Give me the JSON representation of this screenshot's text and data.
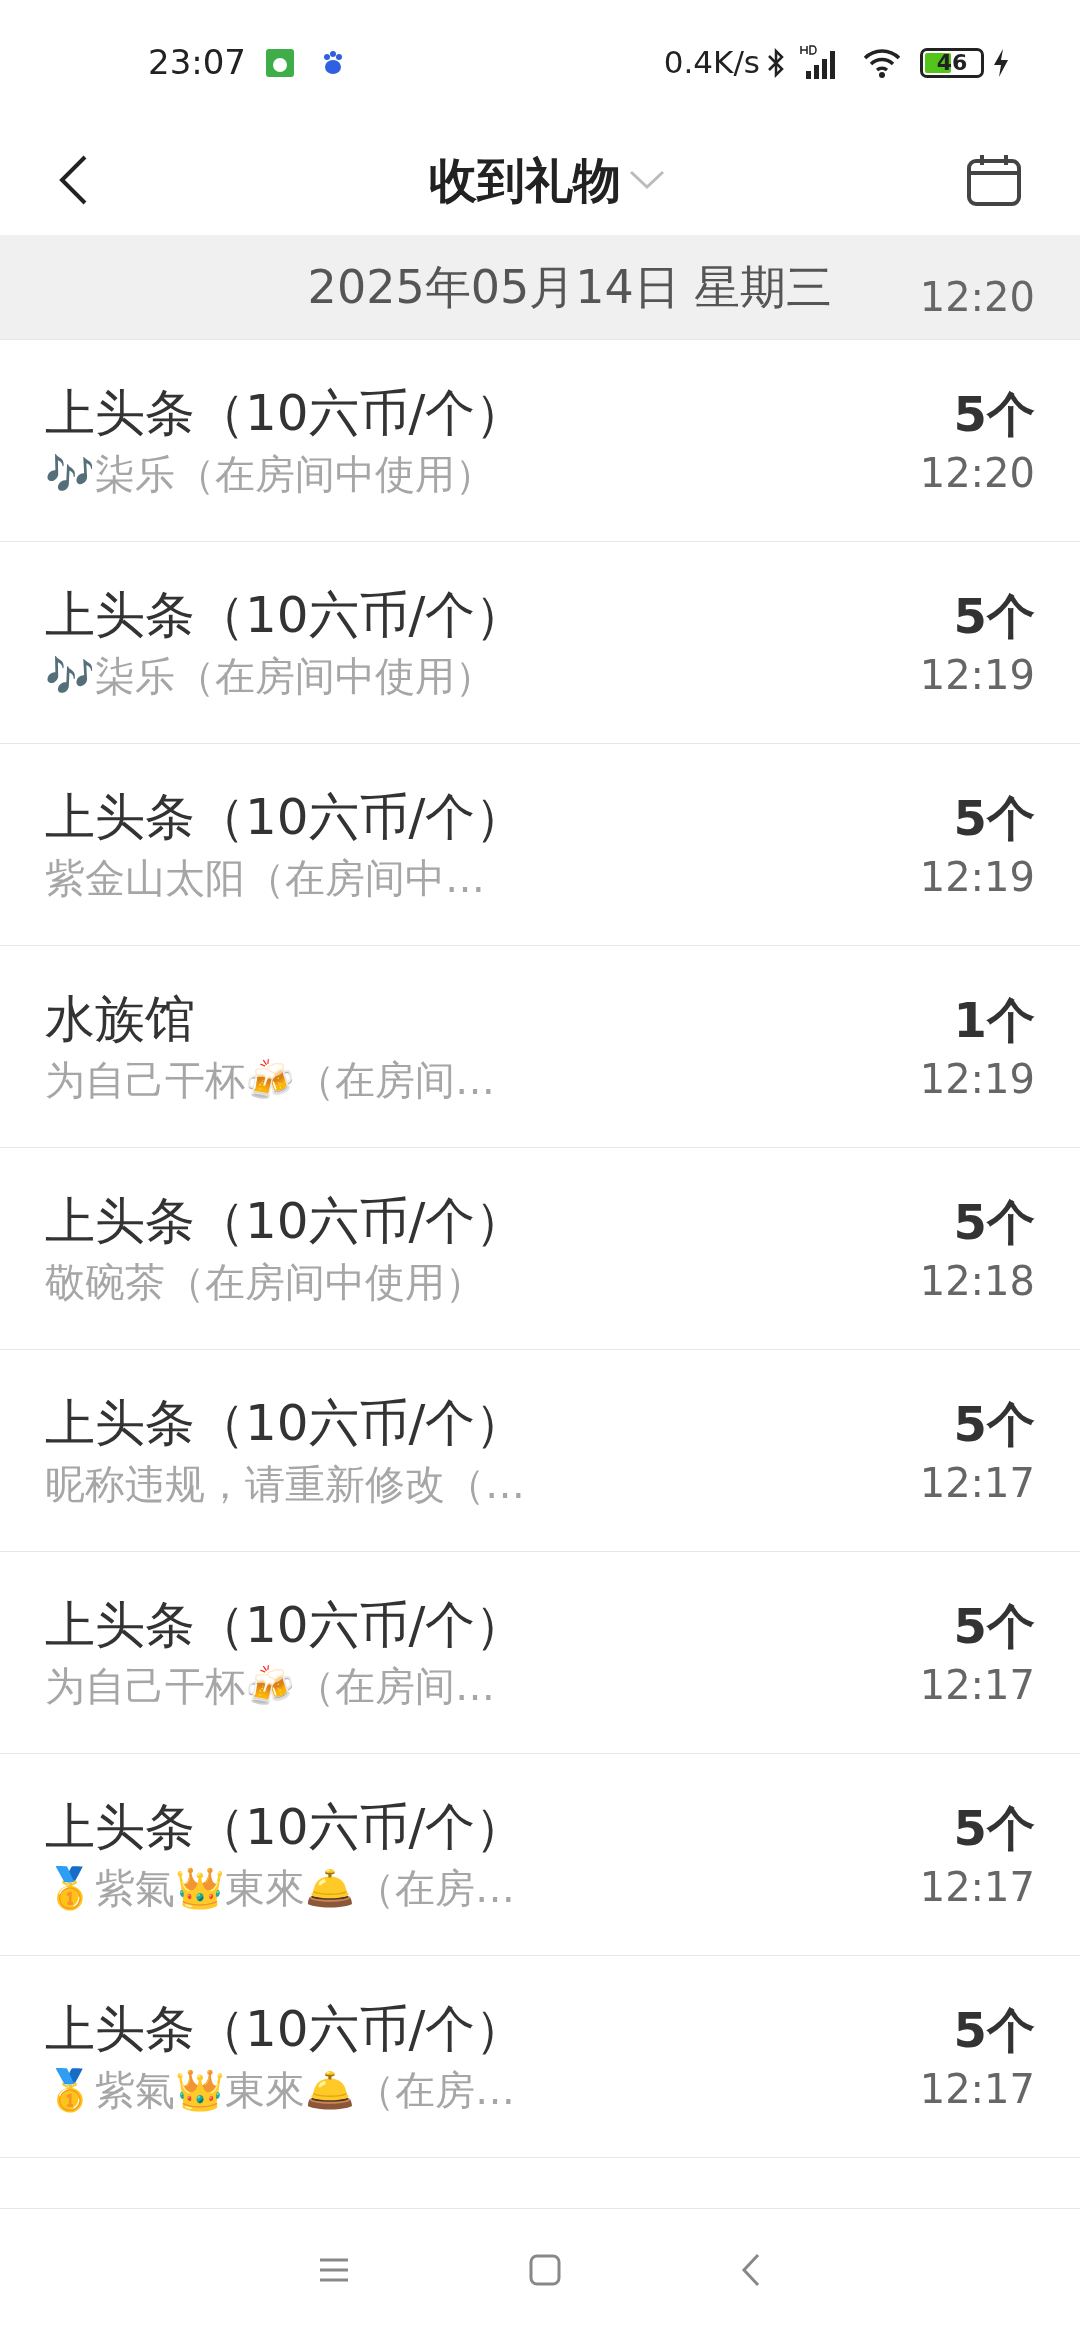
{
  "status_bar": {
    "time": "23:07",
    "net_speed": "0.4K/s",
    "battery": "46"
  },
  "header": {
    "title": "收到礼物"
  },
  "date_header": "2025年05月14日 星期三",
  "partial_row": {
    "time": "12:20"
  },
  "gifts": [
    {
      "name": "上头条（10六币/个）",
      "sender": "🎶柒乐（在房间中使用）",
      "count": "5个",
      "time": "12:20"
    },
    {
      "name": "上头条（10六币/个）",
      "sender": "🎶柒乐（在房间中使用）",
      "count": "5个",
      "time": "12:19"
    },
    {
      "name": "上头条（10六币/个）",
      "sender": "紫金山太阳（在房间中…",
      "count": "5个",
      "time": "12:19"
    },
    {
      "name": "水族馆",
      "sender": "为自己干杯🍻（在房间…",
      "count": "1个",
      "time": "12:19"
    },
    {
      "name": "上头条（10六币/个）",
      "sender": "敬碗茶（在房间中使用）",
      "count": "5个",
      "time": "12:18"
    },
    {
      "name": "上头条（10六币/个）",
      "sender": "昵称违规，请重新修改（…",
      "count": "5个",
      "time": "12:17"
    },
    {
      "name": "上头条（10六币/个）",
      "sender": "为自己干杯🍻（在房间…",
      "count": "5个",
      "time": "12:17"
    },
    {
      "name": "上头条（10六币/个）",
      "sender": "🥇紫氣👑東來🛎️（在房…",
      "count": "5个",
      "time": "12:17"
    },
    {
      "name": "上头条（10六币/个）",
      "sender": "🥇紫氣👑東來🛎️（在房…",
      "count": "5个",
      "time": "12:17"
    }
  ]
}
